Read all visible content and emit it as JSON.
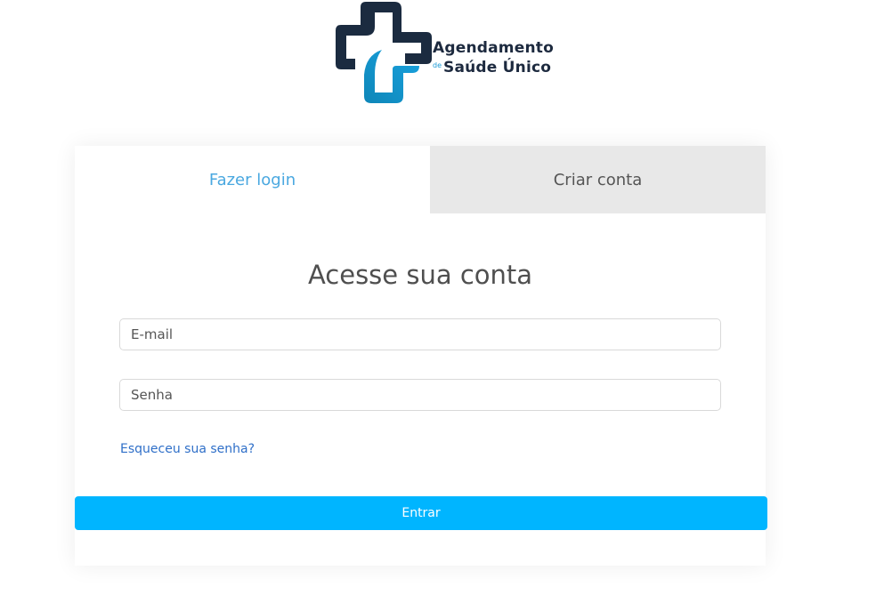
{
  "logo": {
    "line1": "Agendamento",
    "de": "de",
    "line2": "Saúde Único",
    "colors": {
      "dark": "#1b2b40",
      "accent": "#1a9ad6"
    }
  },
  "tabs": [
    {
      "label": "Fazer login",
      "active": true
    },
    {
      "label": "Criar conta",
      "active": false
    }
  ],
  "form": {
    "title": "Acesse sua conta",
    "email_placeholder": "E-mail",
    "email_value": "",
    "password_placeholder": "Senha",
    "password_value": "",
    "forgot_link": "Esqueceu sua senha?",
    "submit_label": "Entrar"
  },
  "colors": {
    "primary_button": "#00b5ff",
    "active_tab_text": "#4aa8e0",
    "inactive_tab_bg": "#e8e8e8",
    "link": "#2f6fc8"
  }
}
